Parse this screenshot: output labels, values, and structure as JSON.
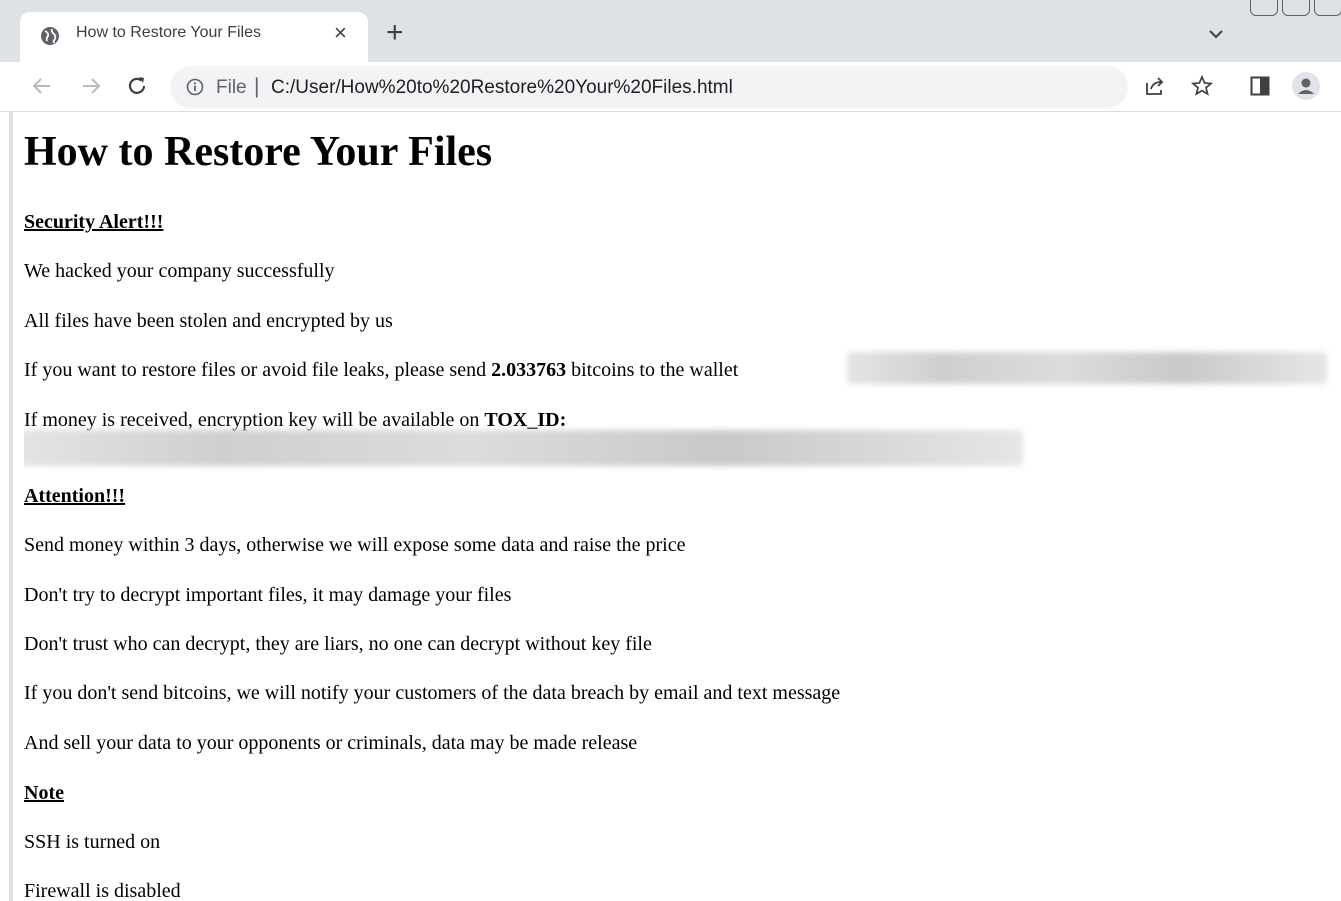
{
  "browser": {
    "tab": {
      "title": "How to Restore Your Files",
      "close_glyph": "×"
    },
    "new_tab_glyph": "+",
    "address": {
      "scheme_label": "File",
      "separator": "|",
      "url": "C:/User/How%20to%20Restore%20Your%20Files.html"
    },
    "icons": {
      "favicon": "globe-icon",
      "back": "arrow-left-icon",
      "forward": "arrow-right-icon",
      "reload": "reload-icon",
      "info": "info-icon",
      "share": "share-icon",
      "bookmark": "star-icon",
      "side_panel": "side-panel-icon",
      "profile": "profile-icon",
      "tab_search": "chevron-down-icon"
    }
  },
  "page": {
    "title": "How to Restore Your Files",
    "security_heading": "Security Alert!!!",
    "line1": "We hacked your company successfully",
    "line2": "All files have been stolen and encrypted by us",
    "line3_pre": "If you want to restore files or avoid file leaks, please send ",
    "line3_amount": "2.033763",
    "line3_post": " bitcoins to the wallet",
    "line4_pre": "If money is received, encryption key will be available on ",
    "line4_bold": "TOX_ID:",
    "attention_heading": "Attention!!!",
    "attention_items": [
      "Send money within 3 days, otherwise we will expose some data and raise the price",
      "Don't try to decrypt important files, it may damage your files",
      "Don't trust who can decrypt, they are liars, no one can decrypt without key file",
      "If you don't send bitcoins, we will notify your customers of the data breach by email and text message",
      "And sell your data to your opponents or criminals, data may be made release"
    ],
    "note_heading": "Note",
    "note_items": [
      "SSH is turned on",
      "Firewall is disabled"
    ]
  }
}
